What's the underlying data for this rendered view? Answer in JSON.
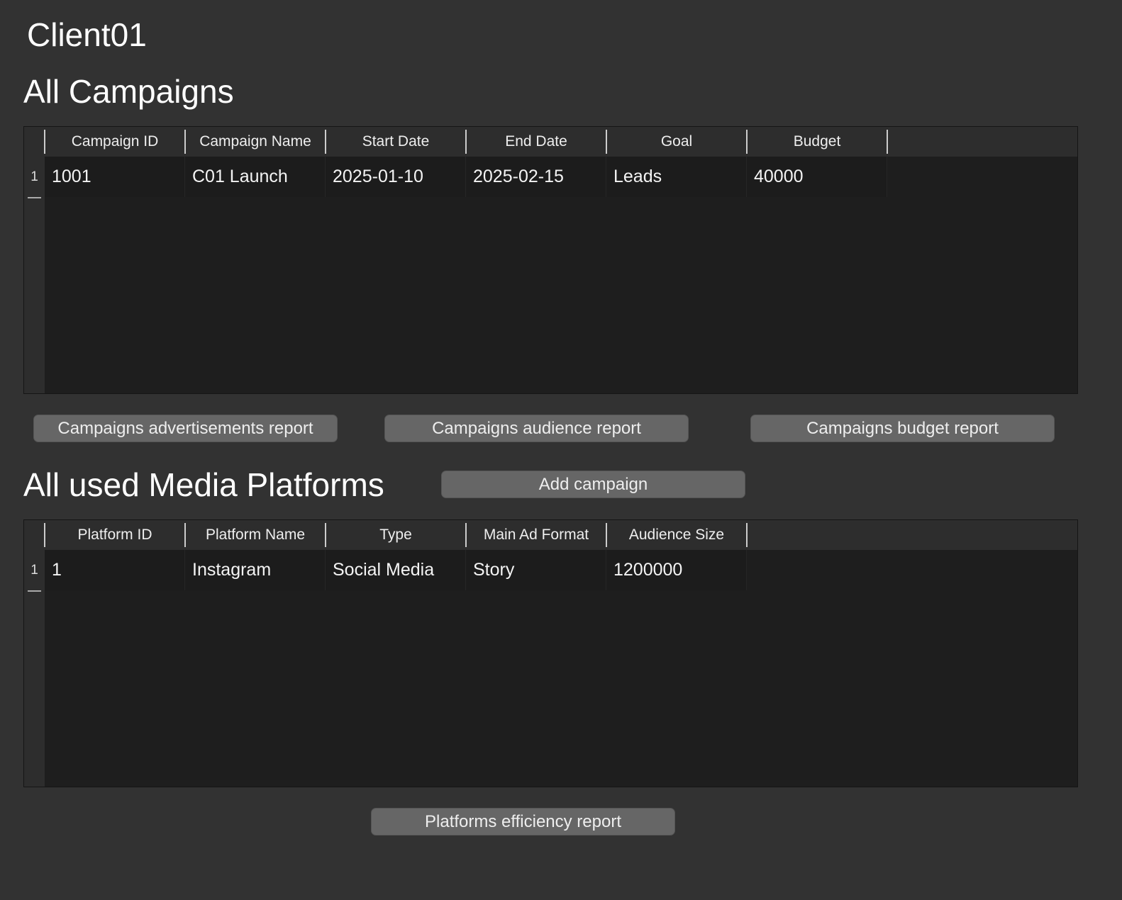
{
  "window_title": "Client01",
  "campaigns": {
    "heading": "All Campaigns",
    "columns": [
      "Campaign ID",
      "Campaign Name",
      "Start Date",
      "End Date",
      "Goal",
      "Budget"
    ],
    "rows": [
      {
        "num": "1",
        "cells": [
          "1001",
          "C01 Launch",
          "2025-01-10",
          "2025-02-15",
          "Leads",
          "40000"
        ]
      }
    ]
  },
  "buttons": {
    "ads_report": "Campaigns advertisements report",
    "audience_report": "Campaigns audience report",
    "budget_report": "Campaigns budget report",
    "add_campaign": "Add campaign",
    "platforms_report": "Platforms efficiency report"
  },
  "platforms": {
    "heading": "All used Media Platforms",
    "columns": [
      "Platform ID",
      "Platform Name",
      "Type",
      "Main Ad Format",
      "Audience Size"
    ],
    "rows": [
      {
        "num": "1",
        "cells": [
          "1",
          "Instagram",
          "Social Media",
          "Story",
          "1200000"
        ]
      }
    ]
  }
}
